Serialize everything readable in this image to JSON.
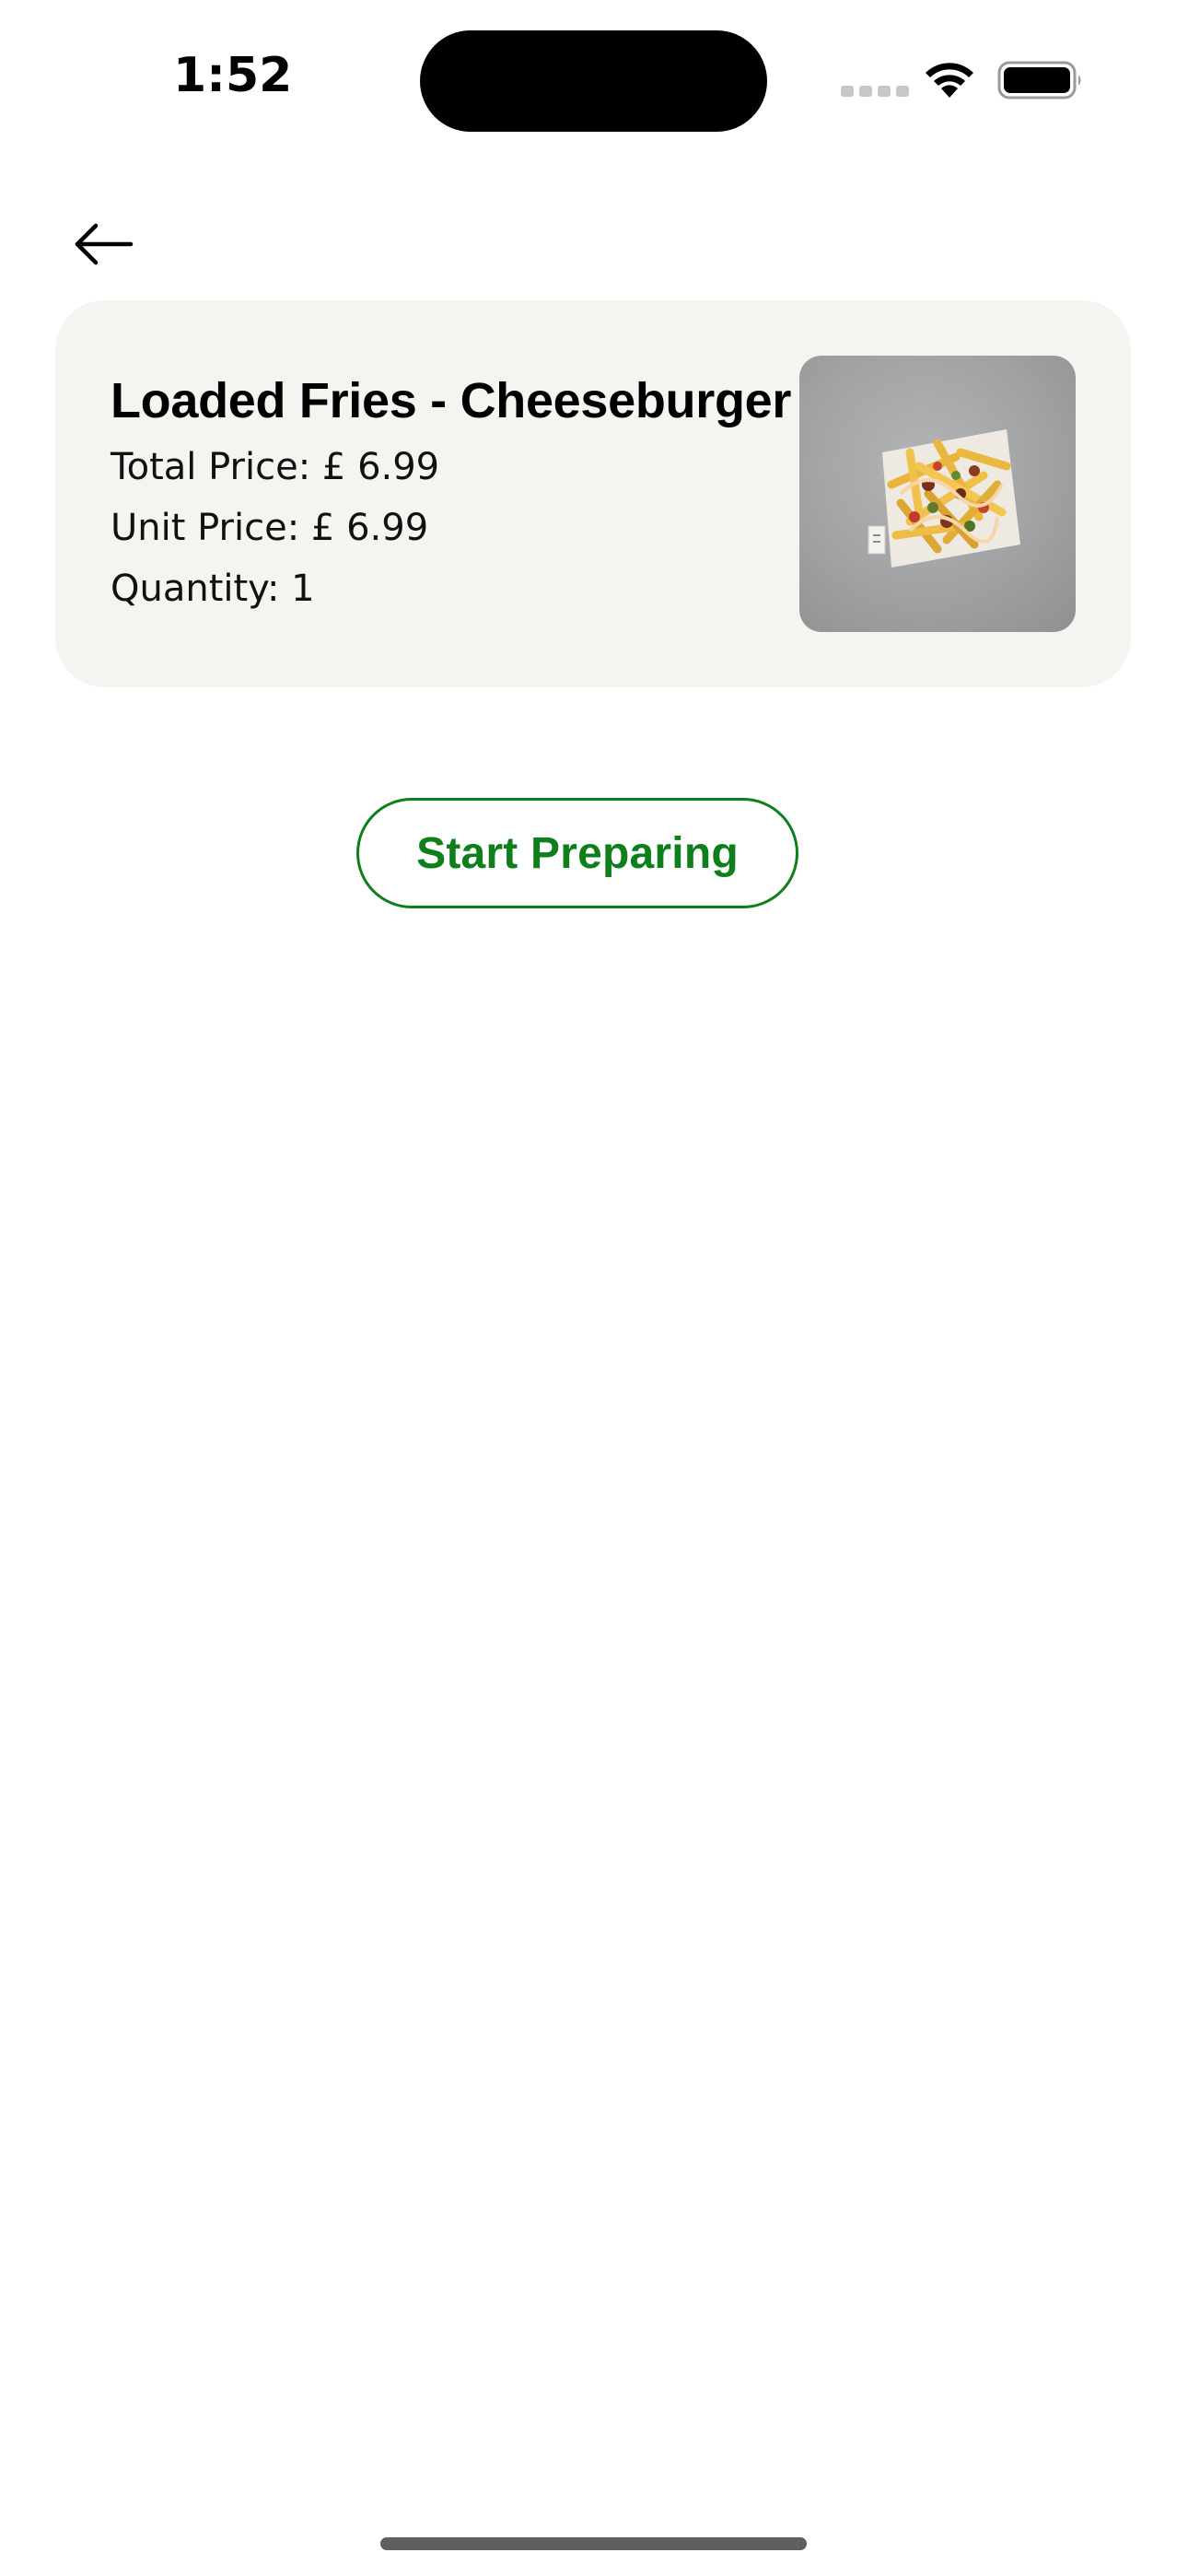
{
  "status_bar": {
    "time": "1:52",
    "icons": [
      "cellular-signal-icon",
      "wifi-icon",
      "battery-icon"
    ]
  },
  "nav": {
    "back_icon": "arrow-left-icon"
  },
  "item": {
    "title": "Loaded Fries - Cheeseburger",
    "total_price": "Total Price: £ 6.99",
    "unit_price": "Unit Price: £ 6.99",
    "quantity": "Quantity: 1",
    "image_icon": "loaded-fries-photo"
  },
  "actions": {
    "start_preparing_label": "Start Preparing"
  },
  "colors": {
    "accent_green": "#0f7f1c",
    "card_background": "#f5f4f0",
    "page_background": "#ffffff"
  }
}
